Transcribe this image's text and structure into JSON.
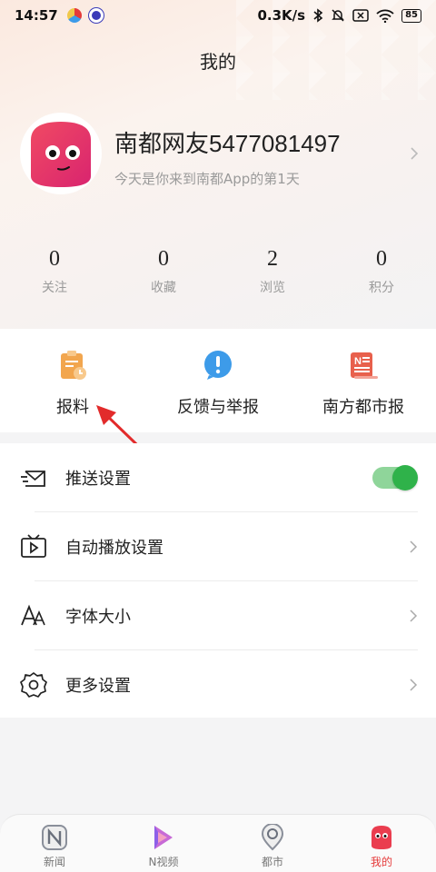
{
  "status_bar": {
    "time": "14:57",
    "network_speed": "0.3K/s",
    "battery": "85"
  },
  "header": {
    "title": "我的"
  },
  "profile": {
    "name": "南都网友5477081497",
    "subtitle": "今天是你来到南都App的第1天"
  },
  "stats": [
    {
      "value": "0",
      "label": "关注"
    },
    {
      "value": "0",
      "label": "收藏"
    },
    {
      "value": "2",
      "label": "浏览"
    },
    {
      "value": "0",
      "label": "积分"
    }
  ],
  "quick_actions": [
    {
      "label": "报料",
      "icon": "clipboard-icon"
    },
    {
      "label": "反馈与举报",
      "icon": "exclamation-icon"
    },
    {
      "label": "南方都市报",
      "icon": "newspaper-icon"
    }
  ],
  "settings": [
    {
      "label": "推送设置",
      "icon": "envelope-icon",
      "control": "toggle",
      "enabled": true
    },
    {
      "label": "自动播放设置",
      "icon": "video-icon",
      "control": "chevron"
    },
    {
      "label": "字体大小",
      "icon": "font-size-icon",
      "control": "chevron"
    },
    {
      "label": "更多设置",
      "icon": "gear-icon",
      "control": "chevron"
    }
  ],
  "bottom_nav": [
    {
      "label": "新闻",
      "icon": "news-icon",
      "active": false
    },
    {
      "label": "N视频",
      "icon": "video-play-icon",
      "active": false
    },
    {
      "label": "都市",
      "icon": "location-icon",
      "active": false
    },
    {
      "label": "我的",
      "icon": "mascot-icon",
      "active": true
    }
  ],
  "colors": {
    "accent": "#e53a3a",
    "toggle_on": "#2fb24a",
    "icon_orange": "#f0a04b",
    "icon_blue": "#3d9be9",
    "icon_red": "#e8604c"
  }
}
